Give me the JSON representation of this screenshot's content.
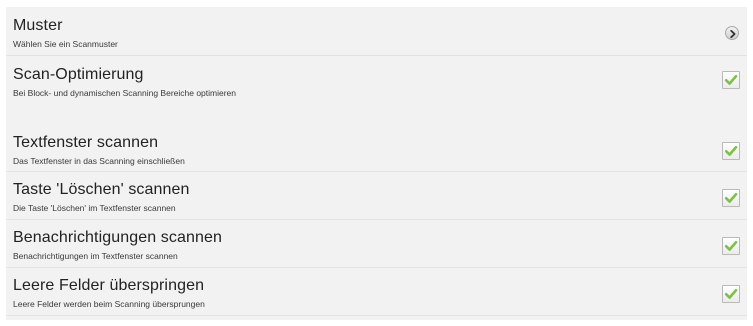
{
  "settings": {
    "items": [
      {
        "title": "Muster",
        "subtitle": "Wählen Sie ein Scanmuster",
        "control": "chevron",
        "control_icon": "chevron-right-icon"
      },
      {
        "title": "Scan-Optimierung",
        "subtitle": "Bei Block- und dynamischen Scanning Bereiche optimieren",
        "control": "checkbox",
        "checked": true
      },
      {
        "title": "Textfenster scannen",
        "subtitle": "Das Textfenster in das Scanning einschließen",
        "control": "checkbox",
        "checked": true
      },
      {
        "title": "Taste 'Löschen' scannen",
        "subtitle": "Die Taste 'Löschen' im Textfenster scannen",
        "control": "checkbox",
        "checked": true
      },
      {
        "title": "Benachrichtigungen scannen",
        "subtitle": "Benachrichtigungen im Textfenster scannen",
        "control": "checkbox",
        "checked": true
      },
      {
        "title": "Leere Felder überspringen",
        "subtitle": "Leere Felder werden beim Scanning übersprungen",
        "control": "checkbox",
        "checked": true
      }
    ]
  },
  "colors": {
    "panel_background": "#f2f2f2",
    "check_green": "#7cc242",
    "divider": "#e2e2e2"
  }
}
